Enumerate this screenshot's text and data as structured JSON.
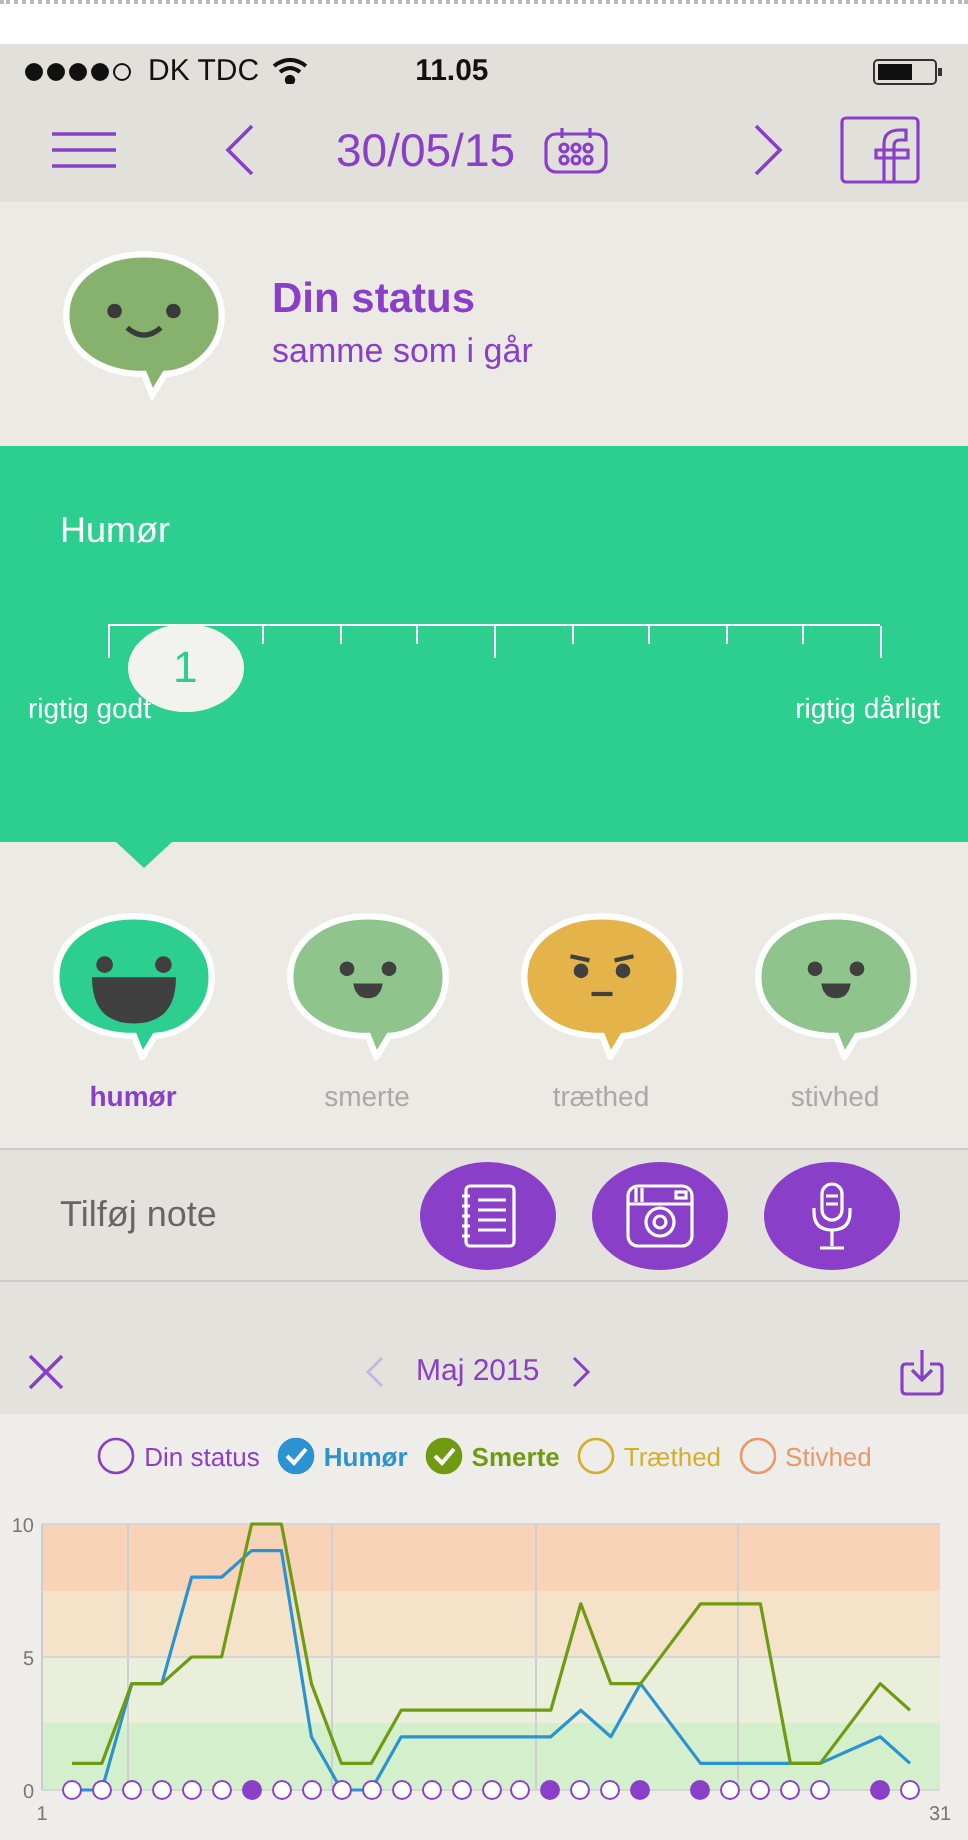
{
  "status_bar": {
    "carrier": "DK TDC",
    "time": "11.05"
  },
  "nav": {
    "date": "30/05/15"
  },
  "status": {
    "title": "Din status",
    "subtitle": "samme som i går"
  },
  "slider": {
    "title": "Humør",
    "value": "1",
    "level": 0.1,
    "min_label": "rigtig godt",
    "max_label": "rigtig dårligt"
  },
  "categories": [
    {
      "label": "humør",
      "selected": true,
      "color": "#2ccf8f",
      "kind": "laugh"
    },
    {
      "label": "smerte",
      "selected": false,
      "color": "#8fc48c",
      "kind": "smile"
    },
    {
      "label": "træthed",
      "selected": false,
      "color": "#e4b44a",
      "kind": "tired"
    },
    {
      "label": "stivhed",
      "selected": false,
      "color": "#8fc48c",
      "kind": "smile"
    }
  ],
  "note": {
    "label": "Tilføj note",
    "buttons": [
      {
        "kind": "notebook"
      },
      {
        "kind": "camera"
      },
      {
        "kind": "microphone"
      }
    ]
  },
  "chart_header": {
    "month": "Maj 2015",
    "prev_disabled": true
  },
  "legend": [
    {
      "label": "Din status",
      "checked": false,
      "color": "#8a3fc9"
    },
    {
      "label": "Humør",
      "checked": true,
      "color": "#2b93d1"
    },
    {
      "label": "Smerte",
      "checked": true,
      "color": "#6f9b13"
    },
    {
      "label": "Træthed",
      "checked": false,
      "color": "#d2b02c"
    },
    {
      "label": "Stivhed",
      "checked": false,
      "color": "#e8996b"
    }
  ],
  "chart_data": {
    "type": "line",
    "x": [
      2,
      3,
      4,
      5,
      6,
      7,
      8,
      9,
      10,
      11,
      12,
      13,
      14,
      15,
      16,
      17,
      18,
      19,
      20,
      21,
      22,
      23,
      24,
      25,
      26,
      27,
      28,
      29,
      30
    ],
    "series": [
      {
        "color": "#2b93d1",
        "values": [
          0,
          0,
          4,
          4,
          8,
          8,
          9,
          9,
          2,
          0,
          0,
          2,
          2,
          2,
          2,
          2,
          2,
          3,
          2,
          4,
          2.5,
          1,
          1,
          1,
          1,
          1,
          1.5,
          2,
          1
        ]
      },
      {
        "color": "#6f9b13",
        "values": [
          1,
          1,
          4,
          4,
          5,
          5,
          10,
          10,
          4,
          1,
          1,
          3,
          3,
          3,
          3,
          3,
          3,
          7,
          4,
          4,
          5.5,
          7,
          7,
          7,
          1,
          1,
          2.5,
          4,
          3
        ]
      }
    ],
    "xlim": [
      1,
      31
    ],
    "ylim": [
      0,
      10
    ],
    "xticks": [
      1,
      31
    ],
    "yticks": [
      0,
      5,
      10
    ]
  },
  "status_dots": [
    {
      "shown": true,
      "filled": false
    },
    {
      "shown": true,
      "filled": false
    },
    {
      "shown": true,
      "filled": false
    },
    {
      "shown": true,
      "filled": false
    },
    {
      "shown": true,
      "filled": false
    },
    {
      "shown": true,
      "filled": false
    },
    {
      "shown": true,
      "filled": true
    },
    {
      "shown": true,
      "filled": false
    },
    {
      "shown": true,
      "filled": false
    },
    {
      "shown": true,
      "filled": false
    },
    {
      "shown": true,
      "filled": false
    },
    {
      "shown": true,
      "filled": false
    },
    {
      "shown": true,
      "filled": false
    },
    {
      "shown": true,
      "filled": false
    },
    {
      "shown": true,
      "filled": false
    },
    {
      "shown": true,
      "filled": false
    },
    {
      "shown": true,
      "filled": true
    },
    {
      "shown": true,
      "filled": false
    },
    {
      "shown": true,
      "filled": false
    },
    {
      "shown": true,
      "filled": true
    },
    {
      "shown": false
    },
    {
      "shown": true,
      "filled": true
    },
    {
      "shown": true,
      "filled": false
    },
    {
      "shown": true,
      "filled": false
    },
    {
      "shown": true,
      "filled": false
    },
    {
      "shown": true,
      "filled": false
    },
    {
      "shown": false
    },
    {
      "shown": true,
      "filled": true
    },
    {
      "shown": true,
      "filled": false
    }
  ]
}
